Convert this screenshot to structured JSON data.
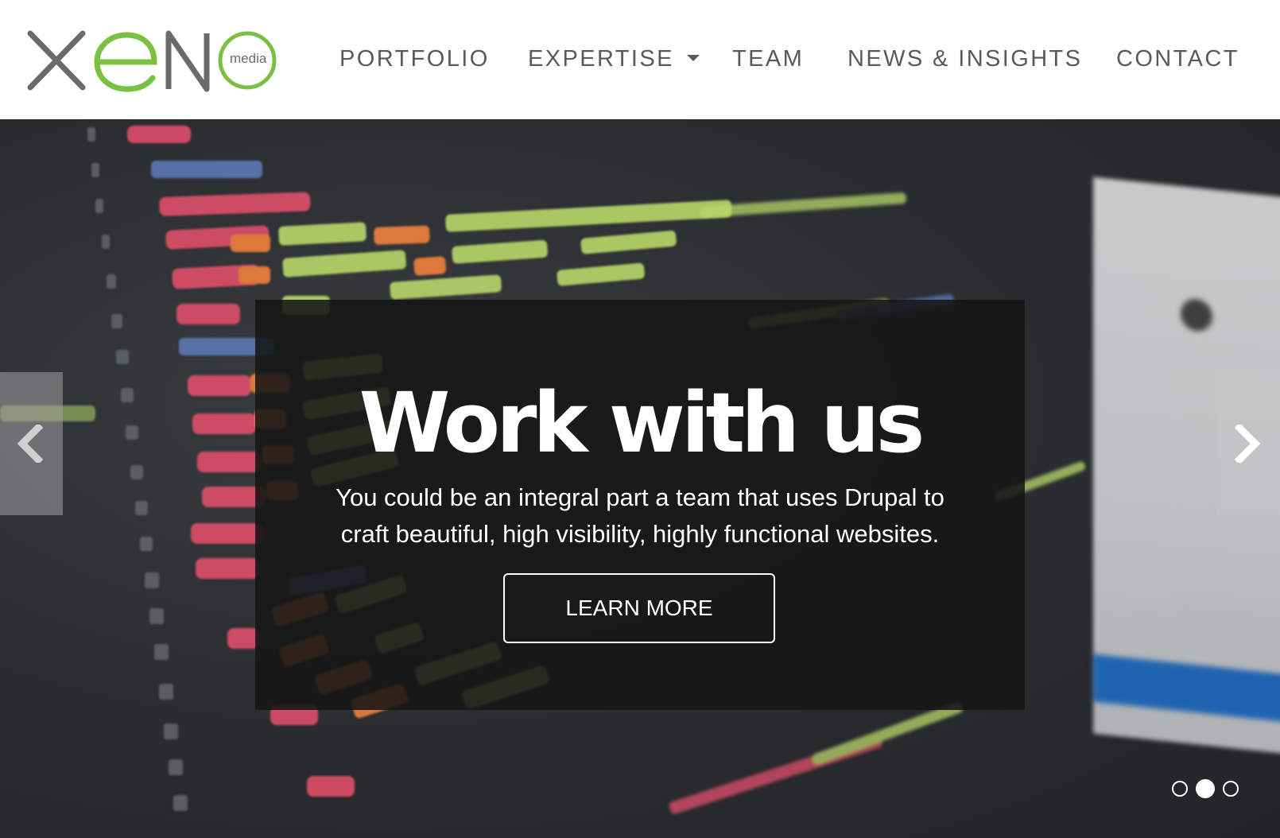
{
  "logo": {
    "brand": "xeno",
    "sub": "media"
  },
  "nav": {
    "items": [
      {
        "label": "PORTFOLIO"
      },
      {
        "label": "EXPERTISE",
        "dropdown": true
      },
      {
        "label": "TEAM"
      },
      {
        "label": "NEWS & INSIGHTS"
      },
      {
        "label": "CONTACT"
      }
    ]
  },
  "hero": {
    "title": "Work with us",
    "subtitle_line1": "You could be an integral part a team that uses Drupal to",
    "subtitle_line2": "craft beautiful, high visibility, highly functional websites.",
    "button_label": "LEARN MORE",
    "prev_icon": "chevron-left-icon",
    "next_icon": "chevron-right-icon",
    "slides": {
      "count": 3,
      "active": 2
    }
  },
  "colors": {
    "accent_green": "#7ac143",
    "logo_gray": "#6b6b6b",
    "nav_text": "#5a5a5a",
    "overlay": "#161616"
  }
}
